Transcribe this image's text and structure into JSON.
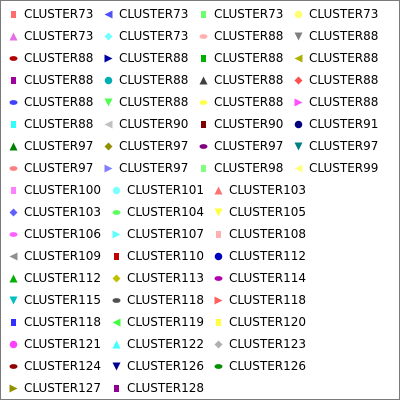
{
  "legend": {
    "rows": [
      [
        {
          "label": "CLUSTER73",
          "marker": "square-icon",
          "color": "#ff6e6e"
        },
        {
          "label": "CLUSTER73",
          "marker": "triangle-left-icon",
          "color": "#5050ff"
        },
        {
          "label": "CLUSTER73",
          "marker": "square-icon",
          "color": "#6eff6e"
        },
        {
          "label": "CLUSTER73",
          "marker": "circle-icon",
          "color": "#ffff6e"
        }
      ],
      [
        {
          "label": "CLUSTER73",
          "marker": "triangle-up-icon",
          "color": "#e46ee4"
        },
        {
          "label": "CLUSTER73",
          "marker": "diamond-icon",
          "color": "#6effff"
        },
        {
          "label": "CLUSTER88",
          "marker": "ellipse-icon",
          "color": "#ffb0b0"
        },
        {
          "label": "CLUSTER88",
          "marker": "triangle-down-icon",
          "color": "#808080"
        }
      ],
      [
        {
          "label": "CLUSTER88",
          "marker": "ellipse-icon",
          "color": "#b00000"
        },
        {
          "label": "CLUSTER88",
          "marker": "triangle-right-icon",
          "color": "#0000a0"
        },
        {
          "label": "CLUSTER88",
          "marker": "square-icon",
          "color": "#00b000"
        },
        {
          "label": "CLUSTER88",
          "marker": "triangle-left-icon",
          "color": "#b0b000"
        }
      ],
      [
        {
          "label": "CLUSTER88",
          "marker": "square-icon",
          "color": "#a000a0"
        },
        {
          "label": "CLUSTER88",
          "marker": "circle-icon",
          "color": "#00b0b0"
        },
        {
          "label": "CLUSTER88",
          "marker": "triangle-up-icon",
          "color": "#404040"
        },
        {
          "label": "CLUSTER88",
          "marker": "diamond-icon",
          "color": "#ff5050"
        }
      ],
      [
        {
          "label": "CLUSTER88",
          "marker": "ellipse-icon",
          "color": "#4040ff"
        },
        {
          "label": "CLUSTER88",
          "marker": "triangle-down-icon",
          "color": "#50ff50"
        },
        {
          "label": "CLUSTER88",
          "marker": "ellipse-icon",
          "color": "#ffff50"
        },
        {
          "label": "CLUSTER88",
          "marker": "triangle-right-icon",
          "color": "#ff50ff"
        }
      ],
      [
        {
          "label": "CLUSTER88",
          "marker": "square-icon",
          "color": "#30ffff"
        },
        {
          "label": "CLUSTER90",
          "marker": "triangle-left-icon",
          "color": "#c0c0c0"
        },
        {
          "label": "CLUSTER90",
          "marker": "square-icon",
          "color": "#800000"
        },
        {
          "label": "CLUSTER91",
          "marker": "circle-icon",
          "color": "#000080"
        }
      ],
      [
        {
          "label": "CLUSTER97",
          "marker": "triangle-up-icon",
          "color": "#008000"
        },
        {
          "label": "CLUSTER97",
          "marker": "diamond-icon",
          "color": "#909000"
        },
        {
          "label": "CLUSTER97",
          "marker": "ellipse-icon",
          "color": "#800080"
        },
        {
          "label": "CLUSTER97",
          "marker": "triangle-down-icon",
          "color": "#008080"
        }
      ],
      [
        {
          "label": "CLUSTER97",
          "marker": "ellipse-icon",
          "color": "#ff8080"
        },
        {
          "label": "CLUSTER97",
          "marker": "triangle-right-icon",
          "color": "#8080ff"
        },
        {
          "label": "CLUSTER98",
          "marker": "square-icon",
          "color": "#80ff80"
        },
        {
          "label": "CLUSTER99",
          "marker": "triangle-left-icon",
          "color": "#ffff80"
        }
      ],
      [
        {
          "label": "CLUSTER100",
          "marker": "square-icon",
          "color": "#ff80ff"
        },
        {
          "label": "CLUSTER101",
          "marker": "circle-icon",
          "color": "#80ffff"
        },
        {
          "label": "CLUSTER103",
          "marker": "triangle-up-icon",
          "color": "#ff7070"
        }
      ],
      [
        {
          "label": "CLUSTER103",
          "marker": "diamond-icon",
          "color": "#6060ff"
        },
        {
          "label": "CLUSTER104",
          "marker": "ellipse-icon",
          "color": "#60ff60"
        },
        {
          "label": "CLUSTER105",
          "marker": "triangle-down-icon",
          "color": "#ffff40"
        }
      ],
      [
        {
          "label": "CLUSTER106",
          "marker": "ellipse-icon",
          "color": "#ff60ff"
        },
        {
          "label": "CLUSTER107",
          "marker": "triangle-right-icon",
          "color": "#60ffff"
        },
        {
          "label": "CLUSTER108",
          "marker": "square-icon",
          "color": "#ffb0b0"
        }
      ],
      [
        {
          "label": "CLUSTER109",
          "marker": "triangle-left-icon",
          "color": "#909090"
        },
        {
          "label": "CLUSTER110",
          "marker": "square-icon",
          "color": "#c00000"
        },
        {
          "label": "CLUSTER112",
          "marker": "circle-icon",
          "color": "#0000c0"
        }
      ],
      [
        {
          "label": "CLUSTER112",
          "marker": "triangle-up-icon",
          "color": "#00b000"
        },
        {
          "label": "CLUSTER113",
          "marker": "diamond-icon",
          "color": "#c0c000"
        },
        {
          "label": "CLUSTER114",
          "marker": "ellipse-icon",
          "color": "#b000b0"
        }
      ],
      [
        {
          "label": "CLUSTER115",
          "marker": "triangle-down-icon",
          "color": "#00c0c0"
        },
        {
          "label": "CLUSTER118",
          "marker": "ellipse-icon",
          "color": "#505050"
        },
        {
          "label": "CLUSTER118",
          "marker": "triangle-right-icon",
          "color": "#ff6060"
        }
      ],
      [
        {
          "label": "CLUSTER118",
          "marker": "square-icon",
          "color": "#3030ff"
        },
        {
          "label": "CLUSTER119",
          "marker": "triangle-left-icon",
          "color": "#40ff40"
        },
        {
          "label": "CLUSTER120",
          "marker": "square-icon",
          "color": "#ffff40"
        }
      ],
      [
        {
          "label": "CLUSTER121",
          "marker": "circle-icon",
          "color": "#ff40ff"
        },
        {
          "label": "CLUSTER122",
          "marker": "triangle-up-icon",
          "color": "#40ffff"
        },
        {
          "label": "CLUSTER123",
          "marker": "diamond-icon",
          "color": "#b0b0b0"
        }
      ],
      [
        {
          "label": "CLUSTER124",
          "marker": "ellipse-icon",
          "color": "#900000"
        },
        {
          "label": "CLUSTER126",
          "marker": "triangle-down-icon",
          "color": "#000090"
        },
        {
          "label": "CLUSTER126",
          "marker": "ellipse-icon",
          "color": "#009000"
        }
      ],
      [
        {
          "label": "CLUSTER127",
          "marker": "triangle-right-icon",
          "color": "#909000"
        },
        {
          "label": "CLUSTER128",
          "marker": "square-icon",
          "color": "#900090"
        }
      ]
    ]
  }
}
